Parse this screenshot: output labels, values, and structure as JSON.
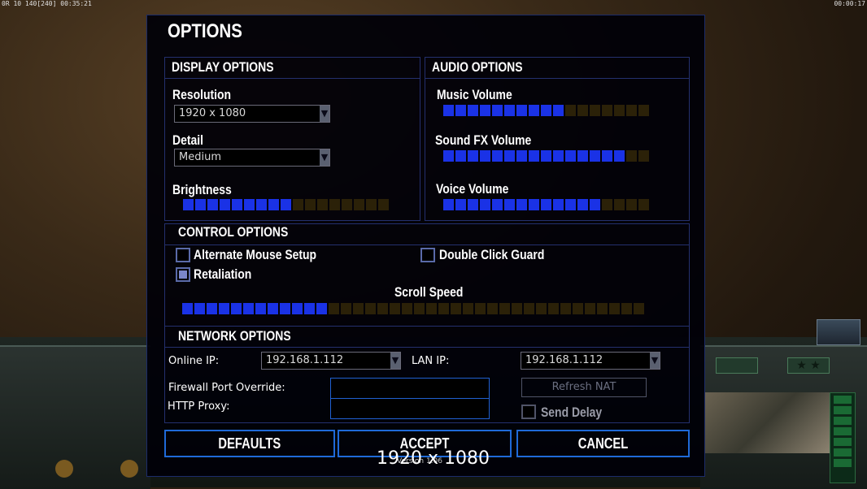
{
  "hud": {
    "left_stats": "0R 10 140[240] 00:35:21",
    "right_clock": "00:00:17"
  },
  "dialog": {
    "title": "OPTIONS"
  },
  "display": {
    "header": "DISPLAY OPTIONS",
    "resolution_label": "Resolution",
    "resolution_value": "1920 x 1080",
    "detail_label": "Detail",
    "detail_value": "Medium",
    "brightness_label": "Brightness",
    "brightness_level": 9,
    "brightness_total": 17
  },
  "audio": {
    "header": "AUDIO OPTIONS",
    "music_label": "Music Volume",
    "music_level": 10,
    "music_total": 17,
    "sfx_label": "Sound FX Volume",
    "sfx_level": 15,
    "sfx_total": 17,
    "voice_label": "Voice Volume",
    "voice_level": 13,
    "voice_total": 17
  },
  "control": {
    "header": "CONTROL OPTIONS",
    "alt_mouse_label": "Alternate Mouse Setup",
    "alt_mouse_checked": false,
    "retaliation_label": "Retaliation",
    "retaliation_checked": true,
    "double_click_label": "Double Click Guard",
    "double_click_checked": false,
    "scroll_label": "Scroll Speed",
    "scroll_level": 12,
    "scroll_total": 38
  },
  "network": {
    "header": "NETWORK OPTIONS",
    "online_ip_label": "Online IP:",
    "online_ip_value": "192.168.1.112",
    "lan_ip_label": "LAN IP:",
    "lan_ip_value": "192.168.1.112",
    "firewall_label": "Firewall Port Override:",
    "firewall_value": "",
    "http_proxy_label": "HTTP Proxy:",
    "http_proxy_value": "",
    "refresh_nat_label": "Refresh NAT",
    "send_delay_label": "Send Delay",
    "send_delay_checked": false
  },
  "buttons": {
    "defaults": "DEFAULTS",
    "accept": "ACCEPT",
    "cancel": "CANCEL"
  },
  "overlay": {
    "resolution_text": "1920 x 1080",
    "version_text": "Version 1.06"
  },
  "colors": {
    "accent_blue": "#1a32e6",
    "button_border": "#1f6ad8",
    "panel_border": "#24306e"
  },
  "icons": [
    "chevron-down-icon",
    "radar-icon",
    "stars-icon",
    "triangle-icon"
  ]
}
